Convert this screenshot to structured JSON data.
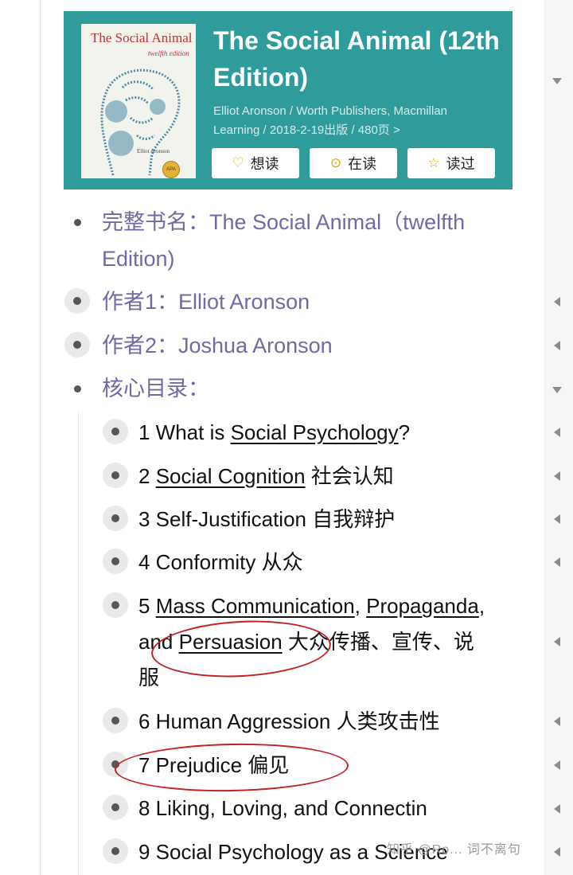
{
  "book": {
    "title": "The Social Animal (12th Edition)",
    "meta": "Elliot Aronson / Worth Publishers, Macmillan Learning / 2018-2-19出版 / 480页 >",
    "cover_title": "The Social Animal",
    "cover_edition": "twelfth edition",
    "cover_author": "Elliot Aronson",
    "buttons": {
      "want": "想读",
      "reading": "在读",
      "read": "读过"
    }
  },
  "meta_list": {
    "full_title": "完整书名：The Social Animal（twelfth Edition)",
    "author1": "作者1：Elliot Aronson",
    "author2": "作者2：Joshua Aronson",
    "toc_heading": "核心目录："
  },
  "toc": {
    "c1_pre": "1 What is ",
    "c1_link": "Social Psychology",
    "c1_post": "?",
    "c2_pre": "2 ",
    "c2_link": "Social Cognition",
    "c2_post": " 社会认知",
    "c3": "3 Self-Justification 自我辩护",
    "c4": "4 Conformity 从众",
    "c5_pre": "5 ",
    "c5_link1": "Mass Communication",
    "c5_mid1": ", ",
    "c5_link2": "Propaganda",
    "c5_mid2": ",",
    "c5_and": "and ",
    "c5_link3": "Persuasion",
    "c5_post": " 大众传播、宣传、说",
    "c5_line3": "服",
    "c6": "6 Human Aggression 人类攻击性",
    "c7": "7 Prejudice 偏见",
    "c8": "8 Liking, Loving, and Connectin",
    "c9": "9 Social Psychology as a Science"
  },
  "watermark": "知乎 @Ro... 词不离句"
}
